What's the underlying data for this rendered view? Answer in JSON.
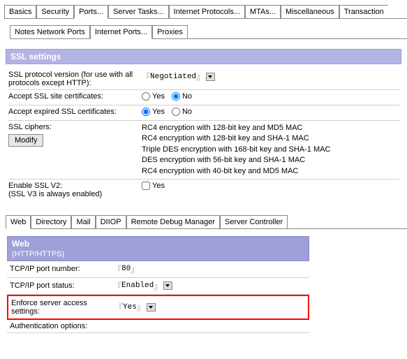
{
  "topTabs": {
    "basics": "Basics",
    "security": "Security",
    "ports": "Ports...",
    "serverTasks": "Server Tasks...",
    "internetProtocols": "Internet Protocols...",
    "mtas": "MTAs...",
    "misc": "Miscellaneous",
    "transactions": "Transaction"
  },
  "subTabs": {
    "notesNetwork": "Notes Network Ports",
    "internetPorts": "Internet Ports...",
    "proxies": "Proxies"
  },
  "sslHeader": "SSL settings",
  "ssl": {
    "protocolLabel": "SSL protocol version (for use with all protocols except HTTP):",
    "protocolValue": "Negotiated",
    "siteCertLabel": "Accept SSL site certificates:",
    "expiredCertLabel": "Accept expired SSL certificates:",
    "yes": "Yes",
    "no": "No",
    "ciphersLabel": "SSL ciphers:",
    "modifyBtn": "Modify",
    "cipher1": "RC4 encryption with 128-bit key and MD5 MAC",
    "cipher2": "RC4 encryption with 128-bit key and SHA-1 MAC",
    "cipher3": "Triple DES encryption with 168-bit key and SHA-1 MAC",
    "cipher4": "DES encryption with 56-bit key and SHA-1 MAC",
    "cipher5": "RC4 encryption with 40-bit key and MD5 MAC",
    "v2Label": "Enable SSL V2:",
    "v2Sub": "(SSL V3 is always enabled)"
  },
  "lowerTabs": {
    "web": "Web",
    "directory": "Directory",
    "mail": "Mail",
    "diiop": "DIIOP",
    "rdm": "Remote Debug Manager",
    "sc": "Server Controller"
  },
  "web": {
    "header": "Web",
    "sub": "(HTTP/HTTPS)",
    "portNumLabel": "TCP/IP port number:",
    "portNumValue": "80",
    "portStatusLabel": "TCP/IP port status:",
    "portStatusValue": "Enabled",
    "enforceLabel": "Enforce server access settings:",
    "enforceValue": "Yes",
    "authLabel": "Authentication options:"
  }
}
